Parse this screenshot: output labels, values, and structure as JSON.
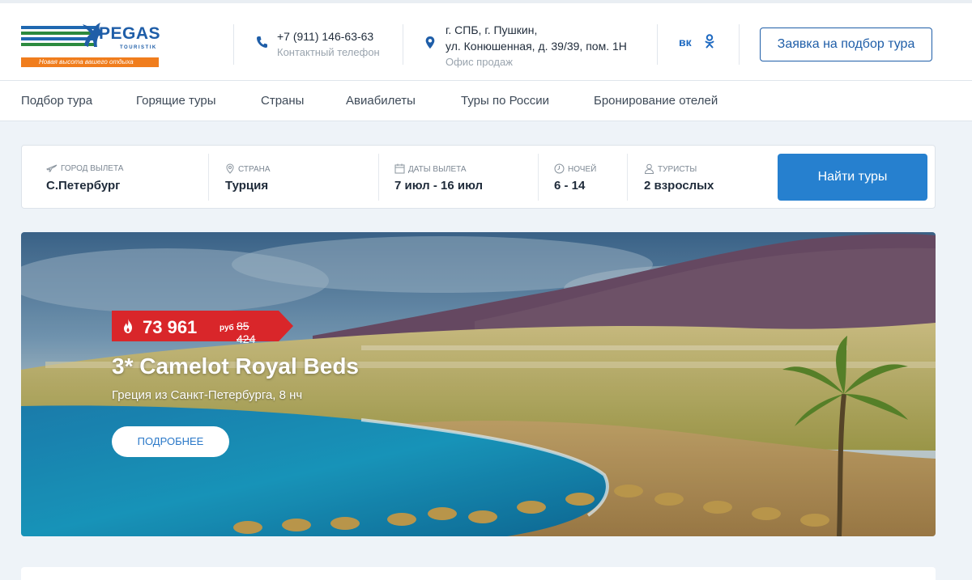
{
  "logo": {
    "brand": "PEGAS",
    "sub": "TOURISTIK",
    "slogan": "Новая высота вашего отдыха"
  },
  "header": {
    "phone": {
      "icon": "phone-icon",
      "value": "+7 (911) 146-63-63",
      "label": "Контактный телефон"
    },
    "office": {
      "icon": "location-pin-icon",
      "line1": "г. СПБ, г. Пушкин,",
      "line2": "ул. Конюшенная, д. 39/39, пом. 1Н",
      "label": "Офис продаж"
    },
    "social": {
      "vk": "вк",
      "ok": "ok"
    },
    "cta_label": "Заявка на подбор тура"
  },
  "nav": [
    "Подбор тура",
    "Горящие туры",
    "Страны",
    "Авиабилеты",
    "Туры по России",
    "Бронирование отелей"
  ],
  "search": {
    "fields": [
      {
        "icon": "plane-icon",
        "label": "Город вылета",
        "value": "С.Петербург"
      },
      {
        "icon": "map-pin-icon",
        "label": "Страна",
        "value": "Турция"
      },
      {
        "icon": "calendar-icon",
        "label": "Даты вылета",
        "value": "7 июл - 16 июл"
      },
      {
        "icon": "clock-icon",
        "label": "Ночей",
        "value": "6 - 14"
      },
      {
        "icon": "user-icon",
        "label": "Туристы",
        "value": "2 взрослых"
      }
    ],
    "button_label": "Найти туры"
  },
  "hero": {
    "price": "73 961",
    "currency": "руб",
    "old_price": "85 424",
    "title": "3* Camelot Royal Beds",
    "subtitle": "Греция из Санкт-Петербурга, 8 нч",
    "button_label": "ПОДРОБНЕЕ"
  },
  "colors": {
    "accent": "#2680cf",
    "brand": "#1f5ea8",
    "price_tag": "#d9262a",
    "orange": "#f07d1d"
  }
}
